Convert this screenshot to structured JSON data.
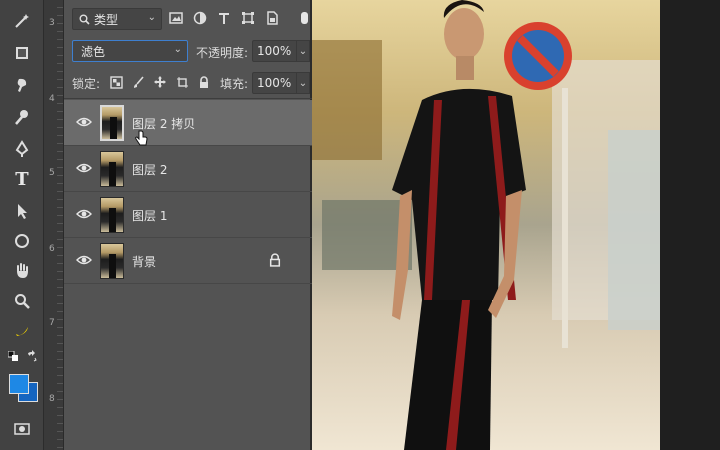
{
  "ruler": {
    "marks": [
      "3",
      "4",
      "5",
      "6",
      "7",
      "8"
    ]
  },
  "layers_panel": {
    "filter": {
      "kind_label": "类型"
    },
    "blend_mode": "滤色",
    "opacity_label": "不透明度:",
    "opacity_value": "100%",
    "lock_label": "锁定:",
    "fill_label": "填充:",
    "fill_value": "100%",
    "layers": [
      {
        "name": "图层 2 拷贝",
        "selected": true
      },
      {
        "name": "图层 2",
        "selected": false
      },
      {
        "name": "图层 1",
        "selected": false
      },
      {
        "name": "背景",
        "selected": false,
        "locked": true
      }
    ]
  },
  "colors": {
    "panel": "#535353",
    "selected_layer": "#6b6b6b",
    "foreground_swatch": "#1e88e5",
    "background_swatch": "#1565c0"
  },
  "icons": {
    "tools": [
      "magic-wand-icon",
      "rectangle-icon",
      "spot-heal-icon",
      "brush-icon",
      "pen-icon",
      "type-tool-icon",
      "arrow-select-icon",
      "ellipse-icon",
      "hand-icon",
      "zoom-icon",
      "banana-icon",
      "swap-colors-icon",
      "quick-mask-icon"
    ],
    "filter": [
      "image-filter-icon",
      "adjustment-filter-icon",
      "type-filter-icon",
      "shape-filter-icon",
      "smart-object-filter-icon"
    ],
    "lock": [
      "lock-pixels-icon",
      "lock-brush-icon",
      "lock-position-icon",
      "lock-artboard-icon",
      "lock-all-icon"
    ]
  }
}
